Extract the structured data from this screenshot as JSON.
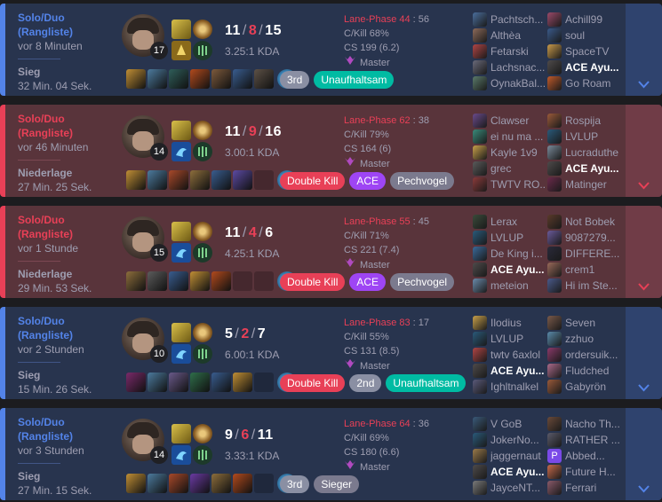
{
  "matches": [
    {
      "result": "win",
      "queue": "Solo/Duo\n(Rangliste)",
      "ago": "vor 8 Minuten",
      "result_label": "Sieg",
      "duration": "32 Min. 04 Sek.",
      "level": "17",
      "kills": "11",
      "deaths": "8",
      "assists": "15",
      "kda_ratio": "3.25:1 KDA",
      "lane_phase_label": "Lane-Phase 44",
      "lane_phase_value": "56",
      "ckill": "C/Kill 68%",
      "cs": "CS 199 (6.2)",
      "rank": "Master",
      "items": [
        "#c08e35",
        "#4c7b9e",
        "#2f5e5a",
        "#b24a1d",
        "#7d5a3c",
        "#395d8f",
        "#5d5146"
      ],
      "badges": [
        {
          "label": "3rd",
          "style": "b-grey"
        },
        {
          "label": "Unaufhaltsam",
          "style": "b-green"
        }
      ],
      "team1": [
        "Pachtsch...",
        "Althèa",
        "Fetarski",
        "Lachsnac...",
        "OynakBal..."
      ],
      "team2": [
        "Achill99",
        "soul",
        "SpaceTV",
        "ACE Ayu...",
        "Go Roam"
      ],
      "team1_colors": [
        "#4a6e9c",
        "#8c6a5a",
        "#b04545",
        "#6a6a7a",
        "#5a7a6a"
      ],
      "team2_colors": [
        "#9a4a6a",
        "#3a5a8a",
        "#c89a4a",
        "#4e4a4a",
        "#c05a2a"
      ]
    },
    {
      "result": "loss",
      "queue": "Solo/Duo\n(Rangliste)",
      "ago": "vor 46 Minuten",
      "result_label": "Niederlage",
      "duration": "27 Min. 25 Sek.",
      "level": "14",
      "kills": "11",
      "deaths": "9",
      "assists": "16",
      "kda_ratio": "3.00:1 KDA",
      "lane_phase_label": "Lane-Phase 62",
      "lane_phase_value": "38",
      "ckill": "C/Kill 79%",
      "cs": "CS 164 (6)",
      "rank": "Master",
      "items": [
        "#c08e35",
        "#4c7b9e",
        "#a8492a",
        "#8d6e3c",
        "#395d8f",
        "#5c4aa3",
        ""
      ],
      "badges": [
        {
          "label": "Double Kill",
          "style": "b-red"
        },
        {
          "label": "ACE",
          "style": "b-purple"
        },
        {
          "label": "Pechvogel",
          "style": "b-darkgrey"
        }
      ],
      "team1": [
        "Clawser",
        "ei nu ma ...",
        "Kayle 1v9",
        "grec",
        "TWTV RO..."
      ],
      "team2": [
        "Rospija",
        "LVLUP",
        "Lucraduthe",
        "ACE Ayu...",
        "Matinger"
      ],
      "team1_colors": [
        "#6a4a8a",
        "#3a8a7a",
        "#c8a04a",
        "#5a5a5a",
        "#8a3a3a"
      ],
      "team2_colors": [
        "#9a5a3a",
        "#2a5a7a",
        "#7a8a9a",
        "#4e4a4a",
        "#6a2a4a"
      ]
    },
    {
      "result": "loss",
      "queue": "Solo/Duo\n(Rangliste)",
      "ago": "vor 1 Stunde",
      "result_label": "Niederlage",
      "duration": "29 Min. 53 Sek.",
      "level": "15",
      "kills": "11",
      "deaths": "4",
      "assists": "6",
      "kda_ratio": "4.25:1 KDA",
      "lane_phase_label": "Lane-Phase 55",
      "lane_phase_value": "45",
      "ckill": "C/Kill 71%",
      "cs": "CS 221 (7.4)",
      "rank": "Master",
      "items": [
        "#8d6e3c",
        "#5c5c5c",
        "#395d8f",
        "#c08e35",
        "#b24a1d",
        "",
        ""
      ],
      "badges": [
        {
          "label": "Double Kill",
          "style": "b-red"
        },
        {
          "label": "ACE",
          "style": "b-purple"
        },
        {
          "label": "Pechvogel",
          "style": "b-darkgrey"
        }
      ],
      "team1": [
        "Lerax",
        "LVLUP",
        "De King i...",
        "ACE Ayu...",
        "meteion"
      ],
      "team2": [
        "Not Bobek",
        "9087279...",
        "DIFFERE...",
        "crem1",
        "Hi im Ste..."
      ],
      "team1_colors": [
        "#3a4a3a",
        "#2a5a7a",
        "#3a6a9a",
        "#4e4a4a",
        "#6a8aaa"
      ],
      "team2_colors": [
        "#5a3a2a",
        "#6a5a9a",
        "#2a2a3a",
        "#9a6a5a",
        "#4a5a8a"
      ]
    },
    {
      "result": "win",
      "queue": "Solo/Duo\n(Rangliste)",
      "ago": "vor 2 Stunden",
      "result_label": "Sieg",
      "duration": "15 Min. 26 Sek.",
      "level": "10",
      "kills": "5",
      "deaths": "2",
      "assists": "7",
      "kda_ratio": "6.00:1 KDA",
      "lane_phase_label": "Lane-Phase 83",
      "lane_phase_value": "17",
      "ckill": "C/Kill 55%",
      "cs": "CS 131 (8.5)",
      "rank": "Master",
      "items": [
        "#7a2a6a",
        "#4c7b9e",
        "#6a5a8a",
        "#2f6e4a",
        "#395d8f",
        "#c08e35"
      ],
      "badges": [
        {
          "label": "Double Kill",
          "style": "b-red"
        },
        {
          "label": "2nd",
          "style": "b-grey"
        },
        {
          "label": "Unaufhaltsam",
          "style": "b-green"
        }
      ],
      "team1": [
        "Ilodius",
        "LVLUP",
        "twtv 6axlol",
        "ACE Ayu...",
        "Ighltnalkel"
      ],
      "team2": [
        "Seven",
        "zzhuo",
        "ordersuik...",
        "Fludched",
        "Gabyrön"
      ],
      "team1_colors": [
        "#c8a04a",
        "#2a5a7a",
        "#b04545",
        "#4e4a4a",
        "#5a5a7a"
      ],
      "team2_colors": [
        "#7a5a4a",
        "#5a8aaa",
        "#8a3a6a",
        "#aa6a8a",
        "#9a5a3a"
      ]
    },
    {
      "result": "win",
      "queue": "Solo/Duo\n(Rangliste)",
      "ago": "vor 3 Stunden",
      "result_label": "Sieg",
      "duration": "27 Min. 15 Sek.",
      "level": "14",
      "kills": "9",
      "deaths": "6",
      "assists": "11",
      "kda_ratio": "3.33:1 KDA",
      "lane_phase_label": "Lane-Phase 64",
      "lane_phase_value": "36",
      "ckill": "C/Kill 69%",
      "cs": "CS 180 (6.6)",
      "rank": "Master",
      "items": [
        "#c08e35",
        "#4c7b9e",
        "#a8492a",
        "#6a3aa3",
        "#8d6e3c",
        "#b24a1d"
      ],
      "badges": [
        {
          "label": "3rd",
          "style": "b-grey"
        },
        {
          "label": "Sieger",
          "style": "b-darkgrey"
        }
      ],
      "team1": [
        "V GoB",
        "JokerNo...",
        "jaggernaut",
        "ACE Ayu...",
        "JayceNT..."
      ],
      "team2": [
        "Nacho Th...",
        "RATHER ...",
        "Abbed...",
        "Future H...",
        "Ferrari"
      ],
      "team1_colors": [
        "#3a5a7a",
        "#2a5a7a",
        "#9a7a4a",
        "#4e4a4a",
        "#7a7a7a"
      ],
      "team2_colors": [
        "#6a4a3a",
        "#5a5a6a",
        "#7a4ae8",
        "#c86a4a",
        "#8a5a6a"
      ]
    }
  ],
  "me_badge": "P",
  "colors": {
    "win": "#5383e8",
    "loss": "#e84057",
    "win_bg": "#28344e",
    "loss_bg": "#59343b"
  }
}
